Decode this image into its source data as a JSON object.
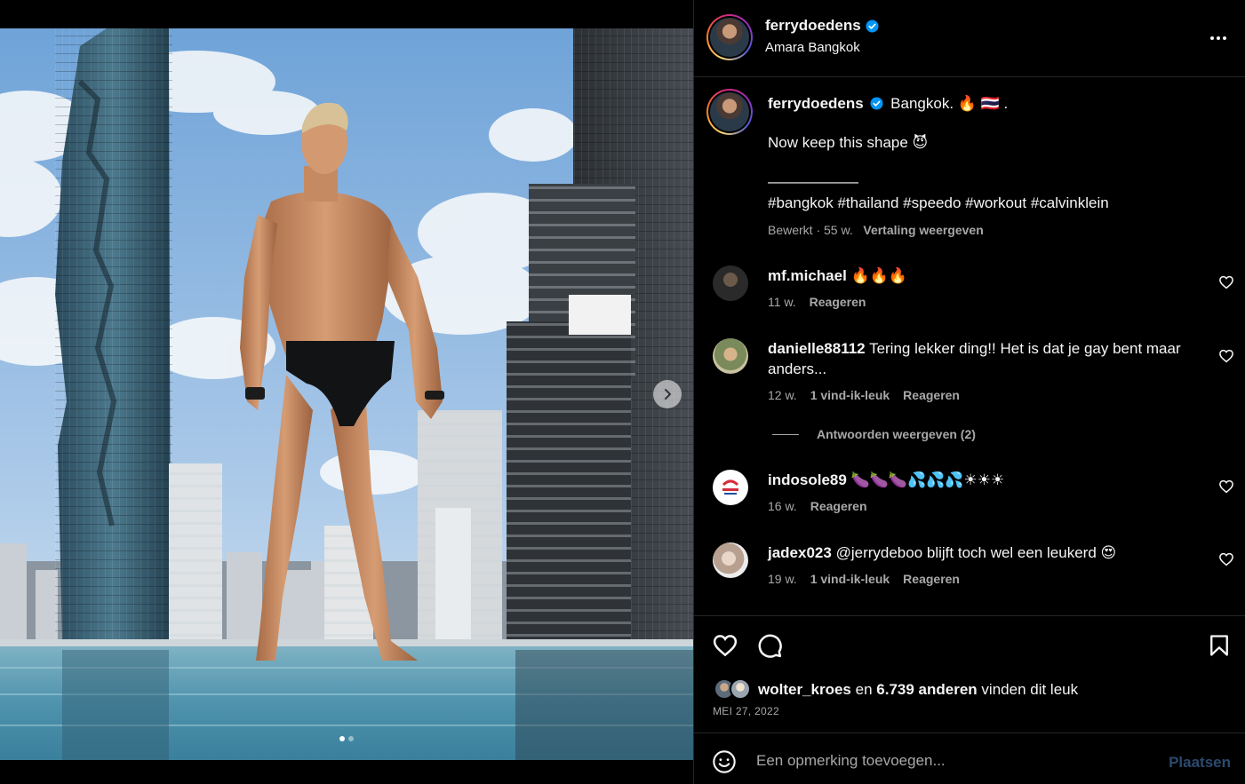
{
  "post": {
    "username": "ferrydoedens",
    "location": "Amara Bangkok",
    "verified": true,
    "carousel": {
      "slide_count": 2,
      "active_index": 0
    }
  },
  "caption": {
    "username": "ferrydoedens",
    "line1": "Bangkok. 🔥 🇹🇭 .",
    "line2": "Now keep this shape 😈",
    "line3": "——————",
    "line4": "#bangkok #thailand #speedo #workout #calvinklein",
    "edited": "Bewerkt · 55 w.",
    "translate": "Vertaling weergeven"
  },
  "comments": [
    {
      "username": "mf.michael",
      "text": "🔥🔥🔥",
      "age": "11 w.",
      "likes": "",
      "reply": "Reageren"
    },
    {
      "username": "danielle88112",
      "text": "Tering lekker ding!! Het is dat je gay bent maar anders...",
      "age": "12 w.",
      "likes": "1 vind-ik-leuk",
      "reply": "Reageren"
    },
    {
      "username": "indosole89",
      "text": "🍆🍆🍆💦💦💦☀☀☀",
      "age": "16 w.",
      "likes": "",
      "reply": "Reageren"
    },
    {
      "username": "jadex023",
      "text": "@jerrydeboo blijft toch wel een leukerd 😍",
      "age": "19 w.",
      "likes": "1 vind-ik-leuk",
      "reply": "Reageren"
    }
  ],
  "view_replies": "Antwoorden weergeven (2)",
  "liked_by": {
    "user": "wolter_kroes",
    "mid": "en",
    "others": "6.739 anderen",
    "suffix": "vinden dit leuk"
  },
  "date": "MEI 27, 2022",
  "add_comment": {
    "placeholder": "Een opmerking toevoegen...",
    "post_label": "Plaatsen"
  },
  "colors": {
    "accent_blue": "#0095f6",
    "muted": "#a8a8a8",
    "bg": "#000000",
    "divider": "#262626"
  },
  "icons": [
    "verified-badge-icon",
    "more-options-icon",
    "heart-icon",
    "comment-icon",
    "bookmark-icon",
    "emoji-icon",
    "chevron-right-icon"
  ]
}
